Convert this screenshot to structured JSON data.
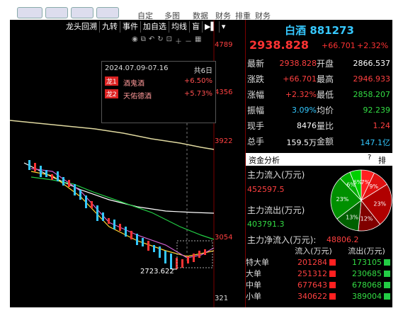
{
  "top_nav": {
    "tabs": [
      "自定",
      "多图",
      "数据",
      "财务",
      "排重",
      "财务"
    ]
  },
  "toolbar": {
    "buttons": [
      "龙头回溯",
      "九转",
      "事件",
      "加自选",
      "均线",
      "盲",
      "▶▌",
      "▾"
    ]
  },
  "price_axis": [
    "4789",
    "4356",
    "3922",
    "3054",
    "321"
  ],
  "info_box": {
    "date_range": "2024.07.09-07.16",
    "days": "共6日",
    "rows": [
      {
        "badge": "龙1",
        "name": "酒鬼酒",
        "pct": "+6.50%"
      },
      {
        "badge": "龙2",
        "name": "天佑德酒",
        "pct": "+5.73%"
      }
    ]
  },
  "low_label": "2723.622",
  "header": {
    "name": "白酒",
    "code": "881273",
    "price": "2938.828",
    "change": "+66.701",
    "change_pct": "+2.32%"
  },
  "quote": [
    {
      "l": "最新",
      "v": "2938.828",
      "vc": "red",
      "l2": "开盘",
      "v2": "2866.537",
      "v2c": "white"
    },
    {
      "l": "涨跌",
      "v": "+66.701",
      "vc": "red",
      "l2": "最高",
      "v2": "2946.933",
      "v2c": "red"
    },
    {
      "l": "涨幅",
      "v": "+2.32%",
      "vc": "red",
      "l2": "最低",
      "v2": "2858.207",
      "v2c": "green"
    },
    {
      "l": "振幅",
      "v": "3.09%",
      "vc": "cyan",
      "l2": "均价",
      "v2": "92.239",
      "v2c": "green"
    },
    {
      "l": "现手",
      "v": "8476",
      "vc": "white",
      "l2": "量比",
      "v2": "1.24",
      "v2c": "red"
    },
    {
      "l": "总手",
      "v": "159.5万",
      "vc": "white",
      "l2": "金额",
      "v2": "147.1亿",
      "v2c": "cyan"
    }
  ],
  "fund": {
    "title": "资金分析",
    "help": "?",
    "rank": "排名",
    "inflow_label": "主力流入(万元)",
    "inflow_value": "452597.5",
    "outflow_label": "主力流出(万元)",
    "outflow_value": "403791.3",
    "net_label": "主力净流入(万元):",
    "net_value": "48806.2",
    "pie": [
      {
        "label": "7%",
        "value": 7,
        "color": "#ff2020"
      },
      {
        "label": "9%",
        "value": 9,
        "color": "#e01010"
      },
      {
        "label": "23%",
        "value": 23,
        "color": "#b00000"
      },
      {
        "label": "12%",
        "value": 12,
        "color": "#800000"
      },
      {
        "label": "13%",
        "value": 13,
        "color": "#006000"
      },
      {
        "label": "23%",
        "value": 23,
        "color": "#009000"
      },
      {
        "label": "6%",
        "value": 6,
        "color": "#00b000"
      },
      {
        "label": "6%",
        "value": 6,
        "color": "#00d000"
      }
    ],
    "table_header": {
      "in": "流入(万元)",
      "out": "流出(万元)"
    },
    "table": [
      {
        "name": "特大单",
        "in": "201284",
        "out": "173105"
      },
      {
        "name": "大单",
        "in": "251312",
        "out": "230685"
      },
      {
        "name": "中单",
        "in": "677643",
        "out": "678068"
      },
      {
        "name": "小单",
        "in": "340622",
        "out": "389004"
      }
    ]
  }
}
